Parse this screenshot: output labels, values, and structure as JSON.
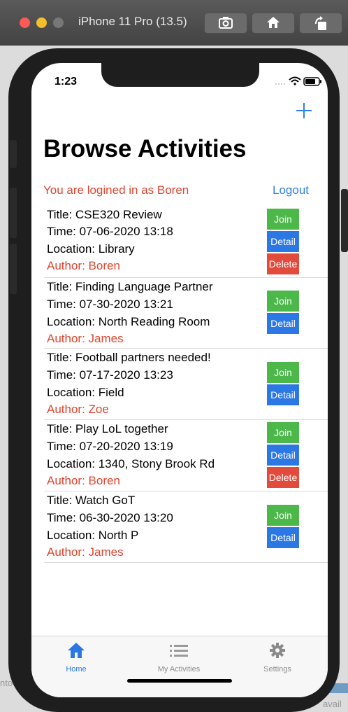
{
  "simulator": {
    "title": "iPhone 11 Pro (13.5)"
  },
  "status_bar": {
    "time": "1:23"
  },
  "header": {
    "title": "Browse Activities"
  },
  "login": {
    "message": "You are logined in as Boren",
    "logout_label": "Logout"
  },
  "buttons": {
    "join": "Join",
    "detail": "Detail",
    "delete": "Delete"
  },
  "activities": [
    {
      "title": "Title: CSE320 Review",
      "time": "Time: 07-06-2020 13:18",
      "location": "Location: Library",
      "author": "Author: Boren",
      "can_delete": true
    },
    {
      "title": "Title: Finding Language Partner",
      "time": "Time: 07-30-2020 13:21",
      "location": "Location: North Reading Room",
      "author": "Author: James",
      "can_delete": false
    },
    {
      "title": "Title: Football partners needed!",
      "time": "Time: 07-17-2020 13:23",
      "location": "Location: Field",
      "author": "Author: Zoe",
      "can_delete": false
    },
    {
      "title": "Title: Play LoL together",
      "time": "Time: 07-20-2020 13:19",
      "location": "Location: 1340, Stony Brook Rd",
      "author": "Author: Boren",
      "can_delete": true
    },
    {
      "title": "Title: Watch GoT",
      "time": "Time: 06-30-2020 13:20",
      "location": "Location: North P",
      "author": "Author: James",
      "can_delete": false
    }
  ],
  "tabs": [
    {
      "label": "Home",
      "icon": "home-icon",
      "active": true
    },
    {
      "label": "My Activities",
      "icon": "list-icon",
      "active": false
    },
    {
      "label": "Settings",
      "icon": "gear-icon",
      "active": false
    }
  ],
  "background_text": {
    "left": "nto",
    "right": "avail"
  },
  "colors": {
    "accent": "#2f80ed",
    "danger": "#e0452f",
    "join": "#4cb84a",
    "detail": "#2b78e4",
    "delete": "#e24a3b"
  }
}
